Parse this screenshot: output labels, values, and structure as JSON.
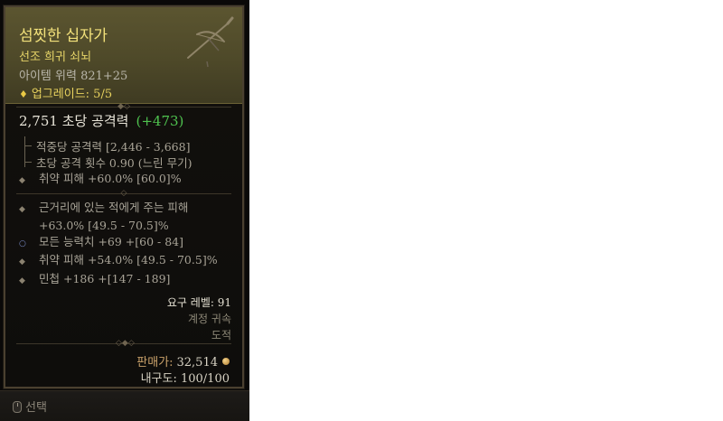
{
  "item": {
    "name": "섬찟한 십자가",
    "type": "선조 희귀 쇠뇌",
    "power": "아이템 위력 821+25",
    "upgrade": "업그레이드: 5/5"
  },
  "dps": {
    "value": "2,751 초당 공격력",
    "bonus": "(+473)"
  },
  "sub_stats": [
    "적중당 공격력 [2,446 - 3,668]",
    "초당 공격 횟수 0.90 (느린 무기)"
  ],
  "implicit": {
    "text": "취약 피해 +60.0% [60.0]%"
  },
  "affixes": [
    {
      "line1": "근거리에 있는 적에게 주는 피해",
      "line2": "+63.0% [49.5 - 70.5]%",
      "bullet": "gray"
    },
    {
      "line1": "모든 능력치 +69 +[60 - 84]",
      "bullet": "blue"
    },
    {
      "line1": "취약 피해 +54.0% [49.5 - 70.5]%",
      "bullet": "gray"
    },
    {
      "line1": "민첩 +186 +[147 - 189]",
      "bullet": "gray"
    }
  ],
  "requirements": {
    "level": "요구 레벨: 91",
    "bound": "계정 귀속",
    "class": "도적"
  },
  "sell": {
    "label": "판매가:",
    "value": "32,514"
  },
  "durability": "내구도: 100/100",
  "footer": {
    "select_label": "선택"
  },
  "icons": {
    "upgrade": "diamond-icon",
    "weapon": "crossbow-icon",
    "coin": "gold-coin-icon",
    "mouse": "mouse-icon"
  },
  "colors": {
    "title": "#f1e07a",
    "rare": "#e6d468",
    "bonus": "#4fc34f",
    "header_bg": "#56512d"
  }
}
